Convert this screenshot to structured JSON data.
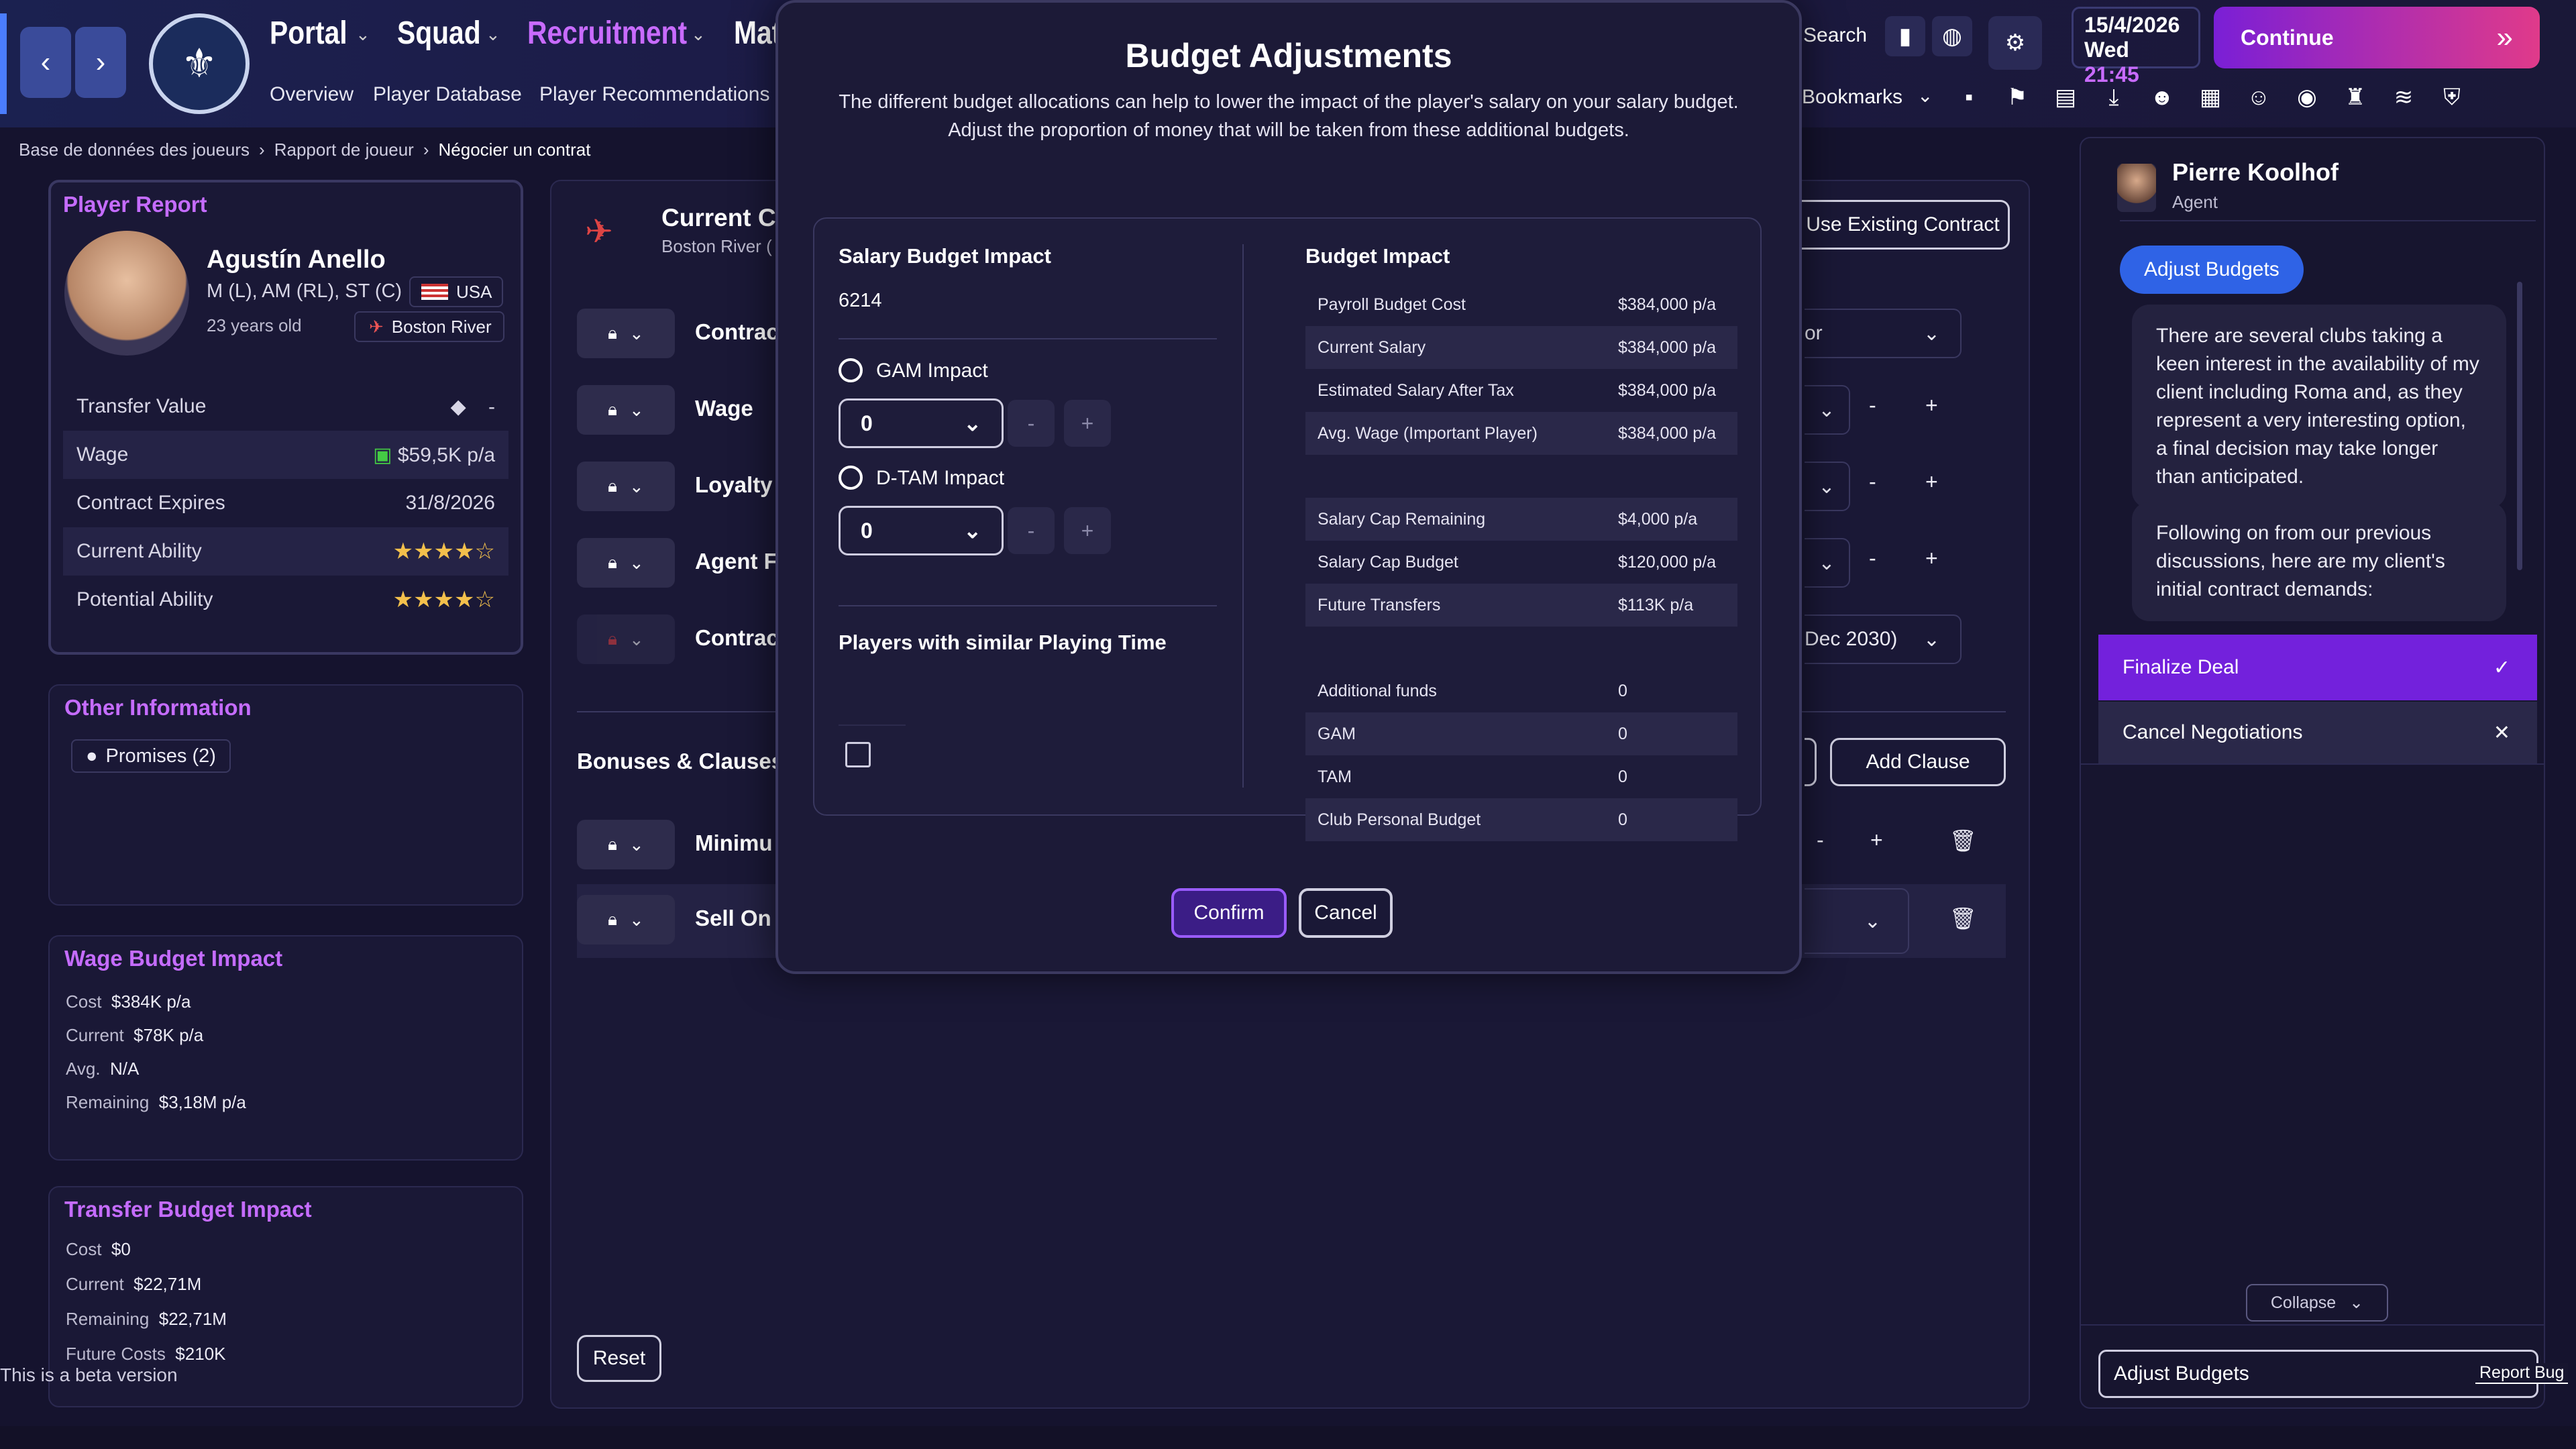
{
  "nav": {
    "main": [
      "Portal",
      "Squad",
      "Recruitment",
      "Mat"
    ],
    "sub": [
      "Overview",
      "Player Database",
      "Player Recommendations"
    ],
    "search": "Search",
    "bookmarks": "Bookmarks",
    "date": "15/4/2026",
    "day": "Wed",
    "time": "21:45",
    "continue": "Continue"
  },
  "breadcrumb": [
    "Base de données des joueurs",
    "Rapport de joueur",
    "Négocier un contrat"
  ],
  "player": {
    "header": "Player Report",
    "name": "Agustín Anello",
    "positions": "M (L), AM (RL), ST (C)",
    "nation": "USA",
    "age": "23 years old",
    "club": "Boston River",
    "rows": [
      {
        "label": "Transfer Value",
        "value": "-"
      },
      {
        "label": "Wage",
        "value": "$59,5K p/a"
      },
      {
        "label": "Contract Expires",
        "value": "31/8/2026"
      },
      {
        "label": "Current Ability",
        "value": "★★★★☆"
      },
      {
        "label": "Potential Ability",
        "value": "★★★★☆"
      }
    ]
  },
  "other": {
    "title": "Other Information",
    "promises": "Promises (2)"
  },
  "wage": {
    "title": "Wage Budget Impact",
    "rows": [
      [
        "Cost",
        "$384K p/a"
      ],
      [
        "Current",
        "$78K p/a"
      ],
      [
        "Avg.",
        "N/A"
      ],
      [
        "Remaining",
        "$3,18M p/a"
      ]
    ]
  },
  "transfer": {
    "title": "Transfer Budget Impact",
    "rows": [
      [
        "Cost",
        "$0"
      ],
      [
        "Current",
        "$22,71M"
      ],
      [
        "Remaining",
        "$22,71M"
      ],
      [
        "Future Costs",
        "$210K"
      ]
    ]
  },
  "beta": "This is a beta version",
  "contract": {
    "title": "Current C",
    "club": "Boston River (",
    "rows": [
      "Contrac",
      "Wage",
      "Loyalty",
      "Agent F",
      "Contrac"
    ],
    "bonuses": "Bonuses & Clauses",
    "clauses": [
      "Minimu",
      "Sell On"
    ],
    "reset": "Reset",
    "use_existing": "Use Existing Contract",
    "add_clause": "Add Clause",
    "right_vals": [
      "or",
      "",
      "",
      "",
      "Dec 2030)"
    ]
  },
  "modal": {
    "title": "Budget Adjustments",
    "desc1": "The different budget allocations can help to lower the impact of the player's salary on your salary budget.",
    "desc2": "Adjust the proportion of money that will be taken from these additional budgets.",
    "salary_title": "Salary Budget Impact",
    "salary_value": "6214",
    "gam_label": "GAM Impact",
    "gam_value": "0",
    "dtam_label": "D-TAM Impact",
    "dtam_value": "0",
    "similar": "Players with similar Playing Time",
    "budget_title": "Budget Impact",
    "rows": [
      [
        "Payroll Budget Cost",
        "$384,000 p/a"
      ],
      [
        "Current Salary",
        "$384,000 p/a"
      ],
      [
        "Estimated Salary After Tax",
        "$384,000 p/a"
      ],
      [
        "Avg. Wage (Important Player)",
        "$384,000 p/a"
      ]
    ],
    "rows2": [
      [
        "Salary Cap Remaining",
        "$4,000 p/a"
      ],
      [
        "Salary Cap Budget",
        "$120,000 p/a"
      ],
      [
        "Future Transfers",
        "$113K p/a"
      ]
    ],
    "rows3": [
      [
        "Additional funds",
        "0"
      ],
      [
        "GAM",
        "0"
      ],
      [
        "TAM",
        "0"
      ],
      [
        "Club Personal Budget",
        "0"
      ]
    ],
    "confirm": "Confirm",
    "cancel": "Cancel",
    "minus": "-",
    "plus": "+"
  },
  "agent": {
    "name": "Pierre Koolhof",
    "role": "Agent",
    "tag": "Adjust Budgets",
    "msg1": "There are several clubs taking a keen interest in the availability of my client including Roma and, as they represent a very interesting option, a final decision may take longer than anticipated.",
    "msg2": "Following on from our previous discussions, here are my client's initial contract demands:",
    "finalize": "Finalize Deal",
    "cancel": "Cancel Negotiations",
    "collapse": "Collapse",
    "input": "Adjust Budgets",
    "report": "Report Bug"
  }
}
